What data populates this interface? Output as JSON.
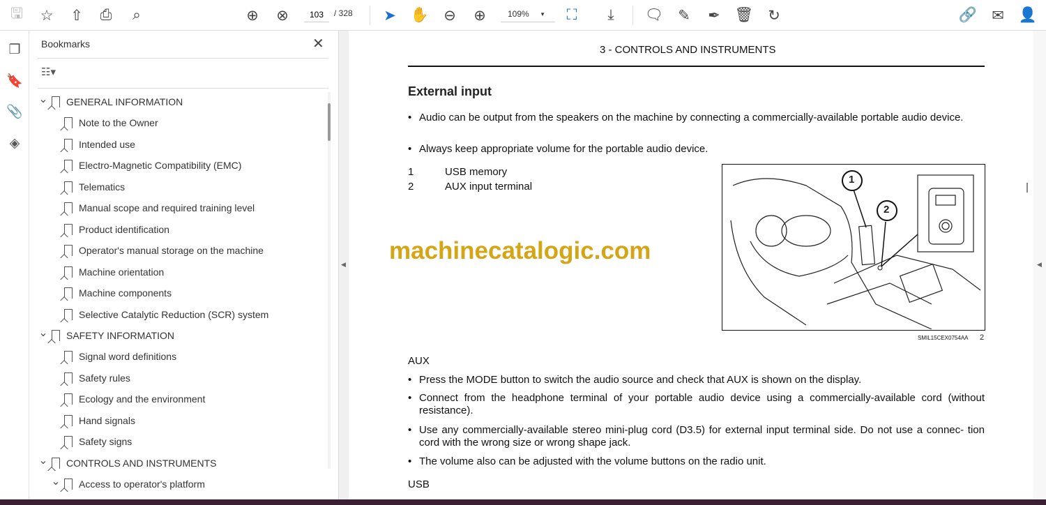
{
  "toolbar": {
    "page_current": "103",
    "page_total": "/ 328",
    "zoom": "109%"
  },
  "bookmarks": {
    "title": "Bookmarks",
    "items": [
      {
        "label": "GENERAL INFORMATION",
        "level": 0,
        "expanded": true
      },
      {
        "label": "Note to the Owner",
        "level": 1
      },
      {
        "label": "Intended use",
        "level": 1
      },
      {
        "label": "Electro-Magnetic Compatibility (EMC)",
        "level": 1
      },
      {
        "label": "Telematics",
        "level": 1
      },
      {
        "label": "Manual scope and required training level",
        "level": 1
      },
      {
        "label": "Product identification",
        "level": 1
      },
      {
        "label": "Operator's manual storage on the machine",
        "level": 1
      },
      {
        "label": "Machine orientation",
        "level": 1
      },
      {
        "label": "Machine components",
        "level": 1
      },
      {
        "label": "Selective Catalytic Reduction (SCR) system",
        "level": 1
      },
      {
        "label": "SAFETY INFORMATION",
        "level": 0,
        "expanded": true
      },
      {
        "label": "Signal word definitions",
        "level": 1
      },
      {
        "label": "Safety rules",
        "level": 1
      },
      {
        "label": "Ecology and the environment",
        "level": 1
      },
      {
        "label": "Hand signals",
        "level": 1
      },
      {
        "label": "Safety signs",
        "level": 1
      },
      {
        "label": "CONTROLS AND INSTRUMENTS",
        "level": 0,
        "expanded": true
      },
      {
        "label": "Access to operator's platform",
        "level": 1,
        "expanded": true
      }
    ]
  },
  "document": {
    "header": "3 - CONTROLS AND INSTRUMENTS",
    "heading": "External input",
    "intro": [
      "Audio can be output from the speakers on the machine by connecting a commercially-available portable audio device.",
      "Always keep appropriate volume for the portable audio device."
    ],
    "legend": [
      {
        "num": "1",
        "label": "USB memory"
      },
      {
        "num": "2",
        "label": "AUX input terminal"
      }
    ],
    "figure_code": "SMIL15CEX0754AA",
    "figure_num": "2",
    "callouts": [
      "1",
      "2"
    ],
    "aux_heading": "AUX",
    "aux_items": [
      "Press the MODE button to switch the audio source and check that AUX is shown on the display.",
      "Connect from the headphone terminal of your portable audio device using a commercially-available cord (without resistance).",
      "Use any commercially-available stereo mini-plug cord (D3.5) for external input terminal side. Do not use a connec- tion cord with the wrong size or wrong shape jack.",
      "The volume also can be adjusted with the volume buttons on the radio unit."
    ],
    "usb_heading": "USB",
    "watermark": "machinecatalogic.com",
    "bullet": "•"
  }
}
